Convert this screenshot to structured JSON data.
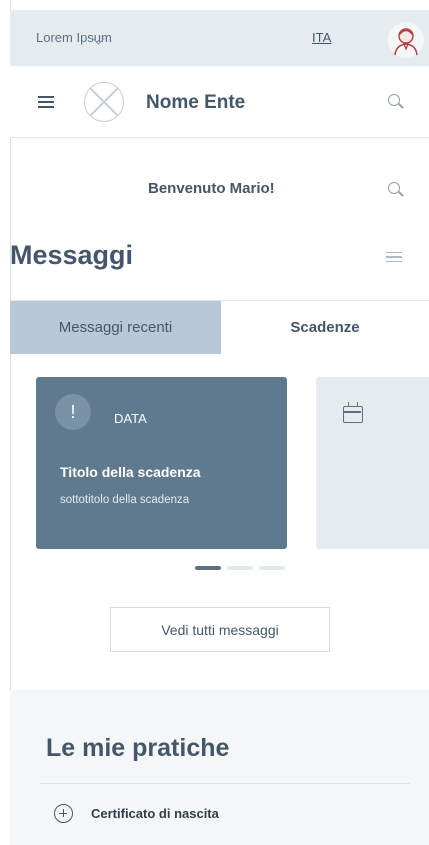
{
  "topbar": {
    "org_label": "Lorem Ipsum",
    "language": "ITA"
  },
  "header": {
    "entity_name": "Nome Ente"
  },
  "welcome": {
    "text": "Benvenuto Mario!"
  },
  "messages": {
    "title": "Messaggi",
    "tabs": [
      {
        "label": "Messaggi recenti",
        "active": false
      },
      {
        "label": "Scadenze",
        "active": true
      }
    ],
    "cards": [
      {
        "icon": "alert-icon",
        "badge": "DATA",
        "title": "Titolo della scadenza",
        "subtitle": "sottotitolo della scadenza",
        "color": "#5f7a8e"
      },
      {
        "icon": "calendar-icon",
        "color": "#e6ebf0"
      }
    ],
    "pagination": {
      "pages": 3,
      "current": 1
    },
    "view_all_label": "Vedi tutti messaggi"
  },
  "pratiche": {
    "title": "Le mie pratiche",
    "items": [
      {
        "icon": "plus-circle-icon",
        "label": "Certificato di nascita"
      }
    ]
  },
  "colors": {
    "primary": "#44576a",
    "card_active": "#5f7a8e",
    "tab_inactive": "#b9c8d6"
  }
}
